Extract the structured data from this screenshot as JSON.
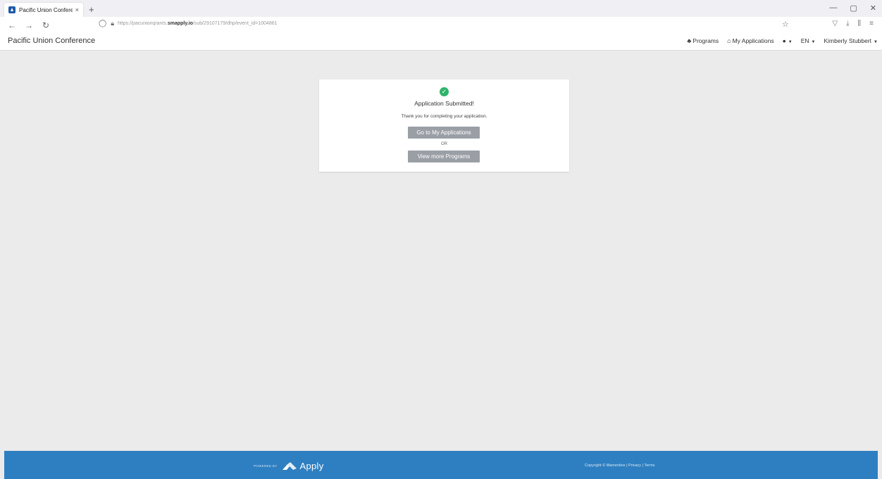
{
  "browser": {
    "tab_title": "Pacific Union Conference",
    "tab_close": "×",
    "new_tab": "+",
    "url_prefix": "https://pacunionqrants.",
    "url_domain": "smapply.io",
    "url_path": "/sub/29107179/dhp/event_id=1004861"
  },
  "header": {
    "brand": "Pacific Union Conference",
    "nav": {
      "programs": "Programs",
      "my_applications": "My Applications",
      "language": "EN",
      "user": "Kimberly Stubbert"
    }
  },
  "card": {
    "title": "Application Submitted!",
    "message": "Thank you for completing your application.",
    "primary_button": "Go to My Applications",
    "or": "OR",
    "secondary_button": "View more Programs"
  },
  "footer": {
    "powered_by": "POWERED BY",
    "brand": "Apply",
    "copyright": "Copyright © Mamentive | Privacy | Terms"
  },
  "colors": {
    "success": "#2fb36b",
    "footer_bg": "#2e7fc1",
    "button_bg": "#9a9fa6",
    "page_bg": "#ebebeb"
  }
}
